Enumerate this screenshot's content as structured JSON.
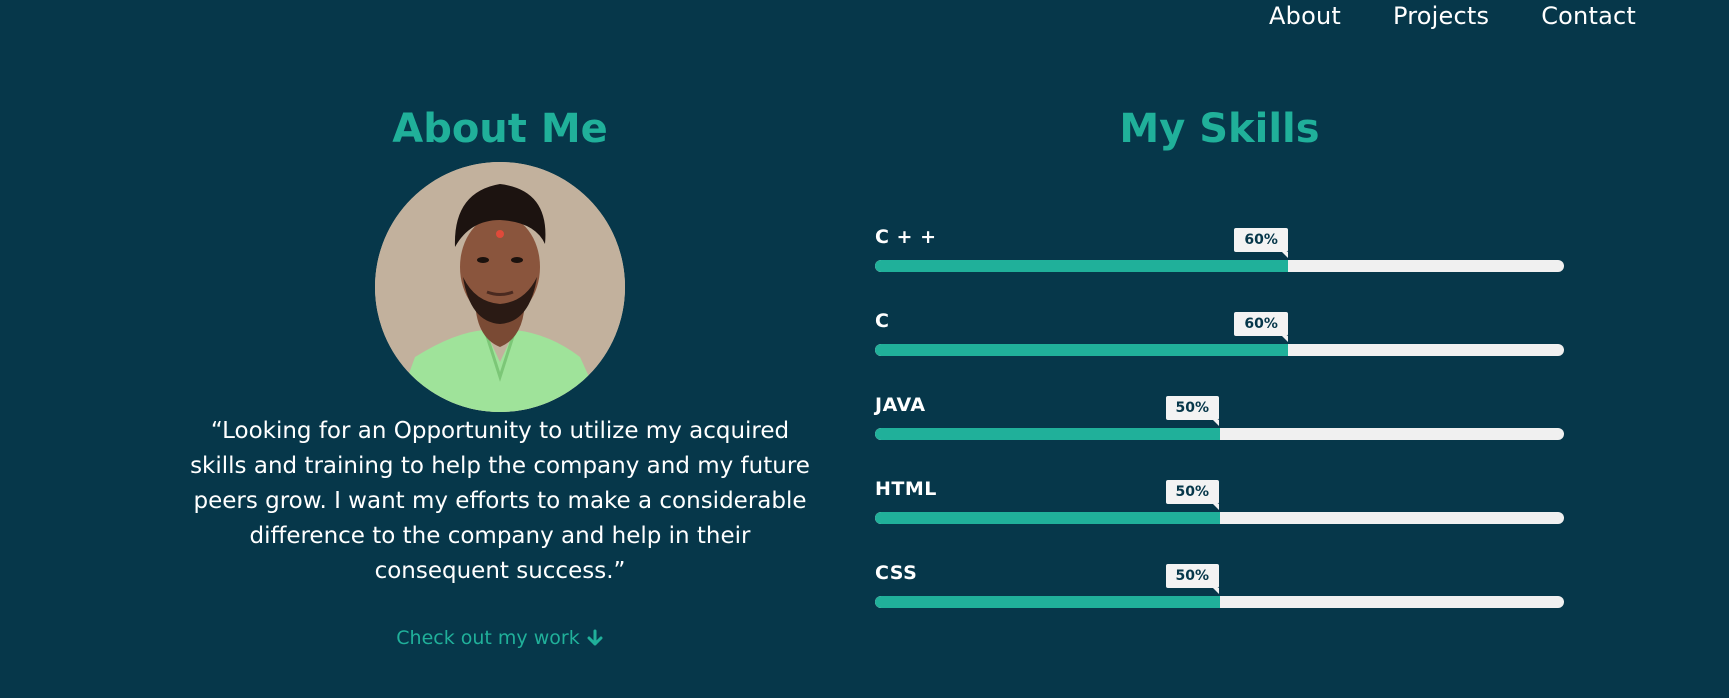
{
  "nav": {
    "links": [
      "About",
      "Projects",
      "Contact"
    ]
  },
  "about": {
    "title": "About Me",
    "quote": "“Looking for an Opportunity to utilize my acquired skills and training to help the company and my future peers grow. I want my efforts to make a considerable difference to the company and help in their consequent success.”",
    "cta_label": "Check out my work",
    "cta_icon": "arrow-down-icon"
  },
  "skills": {
    "title": "My Skills",
    "items": [
      {
        "name": "C + +",
        "percent": 60,
        "label": "60%"
      },
      {
        "name": "C",
        "percent": 60,
        "label": "60%"
      },
      {
        "name": "JAVA",
        "percent": 50,
        "label": "50%"
      },
      {
        "name": "HTML",
        "percent": 50,
        "label": "50%"
      },
      {
        "name": "CSS",
        "percent": 50,
        "label": "50%"
      }
    ]
  },
  "colors": {
    "background": "#06374a",
    "accent": "#20b09a",
    "track": "#f0f0f0",
    "text": "#ffffff"
  }
}
